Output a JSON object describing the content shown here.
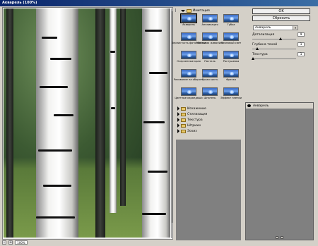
{
  "window": {
    "title": "Акварель (100%)"
  },
  "preview": {
    "zoom": "100%",
    "zoom_minus": "–",
    "zoom_plus": "+"
  },
  "gallery": {
    "open_folder": "Имитация",
    "filters": [
      {
        "label": "Акварель",
        "selected": true
      },
      {
        "label": "Аппликация"
      },
      {
        "label": "Губка"
      },
      {
        "label": "Зернистость фотопленки"
      },
      {
        "label": "Масляная живопись"
      },
      {
        "label": "Неоновый свет"
      },
      {
        "label": "Очерченные края"
      },
      {
        "label": "Пастель"
      },
      {
        "label": "Растушевка"
      },
      {
        "label": "Рисование на обороте"
      },
      {
        "label": "Сухая кисть"
      },
      {
        "label": "Фреска"
      },
      {
        "label": "Цветные карандаши"
      },
      {
        "label": "Шпатель"
      },
      {
        "label": "Эффект пленки"
      }
    ],
    "closed_folders": [
      "Искажение",
      "Стилизация",
      "Текстура",
      "Штрихи",
      "Эскиз"
    ]
  },
  "buttons": {
    "ok": "OK",
    "reset": "Сбросить"
  },
  "filter_select": {
    "value": "Акварель",
    "options": [
      "Акварель"
    ]
  },
  "params": [
    {
      "label": "Детализация",
      "value": "9",
      "level": 0.64
    },
    {
      "label": "Глубина теней",
      "value": "1",
      "level": 0.1
    },
    {
      "label": "Текстура",
      "value": "1",
      "level": 0.0
    }
  ],
  "layers": {
    "items": [
      {
        "label": "Акварель"
      }
    ]
  },
  "icons": {
    "collapse": "chevron-up-icon",
    "eye": "eye-icon",
    "new_layer": "new-layer-icon",
    "delete_layer": "trash-icon"
  }
}
